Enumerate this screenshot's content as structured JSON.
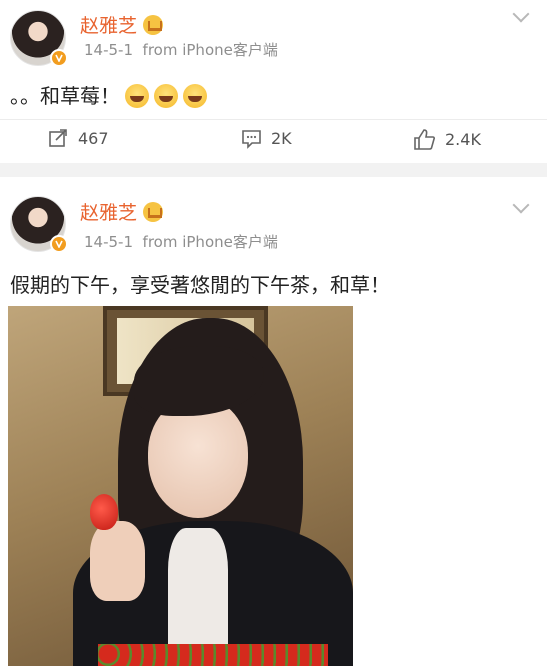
{
  "posts": [
    {
      "username": "赵雅芝",
      "timestamp": "14-5-1",
      "source": "from iPhone客户端",
      "text": "。。和草莓！",
      "emojis": [
        "grin-emoji",
        "grin-sweat-emoji",
        "grin-sweat-emoji"
      ],
      "actions": {
        "repost_count": "467",
        "comment_count": "2K",
        "like_count": "2.4K"
      }
    },
    {
      "username": "赵雅芝",
      "timestamp": "14-5-1",
      "source": "from iPhone客户端",
      "text": "假期的下午，享受著悠閒的下午茶，和草！",
      "image": "photo"
    }
  ],
  "colors": {
    "username": "#e8632f",
    "meta": "#8e8e8e",
    "verified_badge": "#f29d1f"
  }
}
